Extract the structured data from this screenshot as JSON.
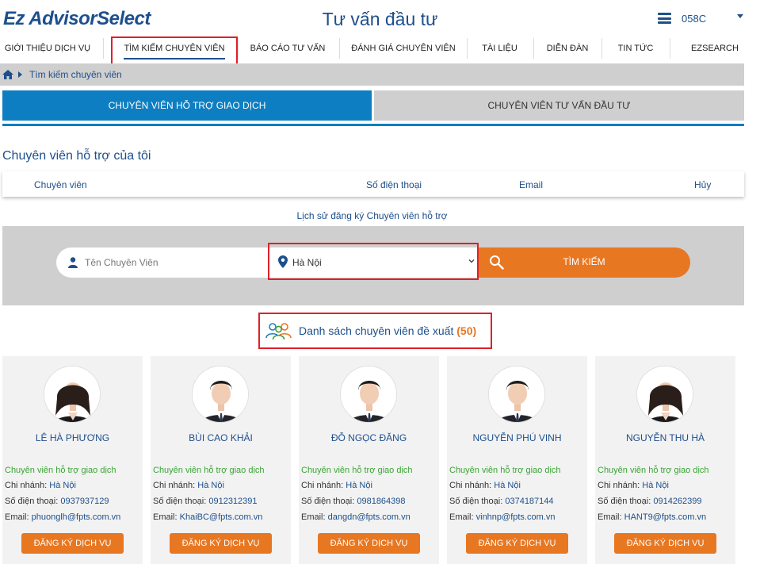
{
  "header": {
    "logo": "Ez AdvisorSelect",
    "title": "Tư vấn đầu tư",
    "user_code": "058C"
  },
  "nav": {
    "items": [
      "GIỚI THIỆU DỊCH VỤ",
      "TÌM KIẾM CHUYÊN VIÊN",
      "BÁO CÁO TƯ VẤN",
      "ĐÁNH GIÁ CHUYÊN VIÊN",
      "TÀI LIỆU",
      "DIỄN ĐÀN",
      "TIN TỨC",
      "EZSEARCH"
    ],
    "active_index": 1
  },
  "breadcrumb": {
    "current": "Tìm kiếm chuyên viên"
  },
  "tabs": [
    {
      "label": "CHUYÊN VIÊN HỖ TRỢ GIAO DỊCH",
      "active": true
    },
    {
      "label": "CHUYÊN VIÊN TƯ VẤN ĐẦU TƯ",
      "active": false
    }
  ],
  "my_advisor": {
    "title": "Chuyên viên hỗ trợ của tôi",
    "columns": [
      "Chuyên viên",
      "Số điện thoại",
      "Email",
      "Hủy"
    ],
    "history_link": "Lịch sử đăng ký Chuyên viên hỗ trợ"
  },
  "search": {
    "name_placeholder": "Tên Chuyên Viên",
    "city_value": "Hà Nội",
    "button_label": "TÌM KIẾM"
  },
  "suggest": {
    "label": "Danh sách chuyên viên đề xuất",
    "count": "(50)"
  },
  "labels": {
    "branch": "Chi nhánh:",
    "phone": "Số điện thoại:",
    "email": "Email:",
    "register": "ĐĂNG KÝ DỊCH VỤ"
  },
  "advisors": [
    {
      "name": "LÊ HÀ PHƯƠNG",
      "role": "Chuyên viên hỗ trợ giao dịch",
      "branch": "Hà Nội",
      "phone": "0937937129",
      "email": "phuonglh@fpts.com.vn"
    },
    {
      "name": "BÙI CAO KHẢI",
      "role": "Chuyên viên hỗ trợ giao dịch",
      "branch": "Hà Nội",
      "phone": "0912312391",
      "email": "KhaiBC@fpts.com.vn"
    },
    {
      "name": "ĐỖ NGỌC ĐĂNG",
      "role": "Chuyên viên hỗ trợ giao dịch",
      "branch": "Hà Nội",
      "phone": "0981864398",
      "email": "dangdn@fpts.com.vn"
    },
    {
      "name": "NGUYỄN PHÚ VINH",
      "role": "Chuyên viên hỗ trợ giao dịch",
      "branch": "Hà Nội",
      "phone": "0374187144",
      "email": "vinhnp@fpts.com.vn"
    },
    {
      "name": "NGUYỄN THU HÀ",
      "role": "Chuyên viên hỗ trợ giao dịch",
      "branch": "Hà Nội",
      "phone": "0914262399",
      "email": "HANT9@fpts.com.vn"
    }
  ],
  "colors": {
    "brand_blue": "#1d4f8c",
    "tab_blue": "#0d7ec1",
    "accent_orange": "#e87722",
    "role_green": "#3aa535",
    "highlight_red": "#e02027"
  }
}
